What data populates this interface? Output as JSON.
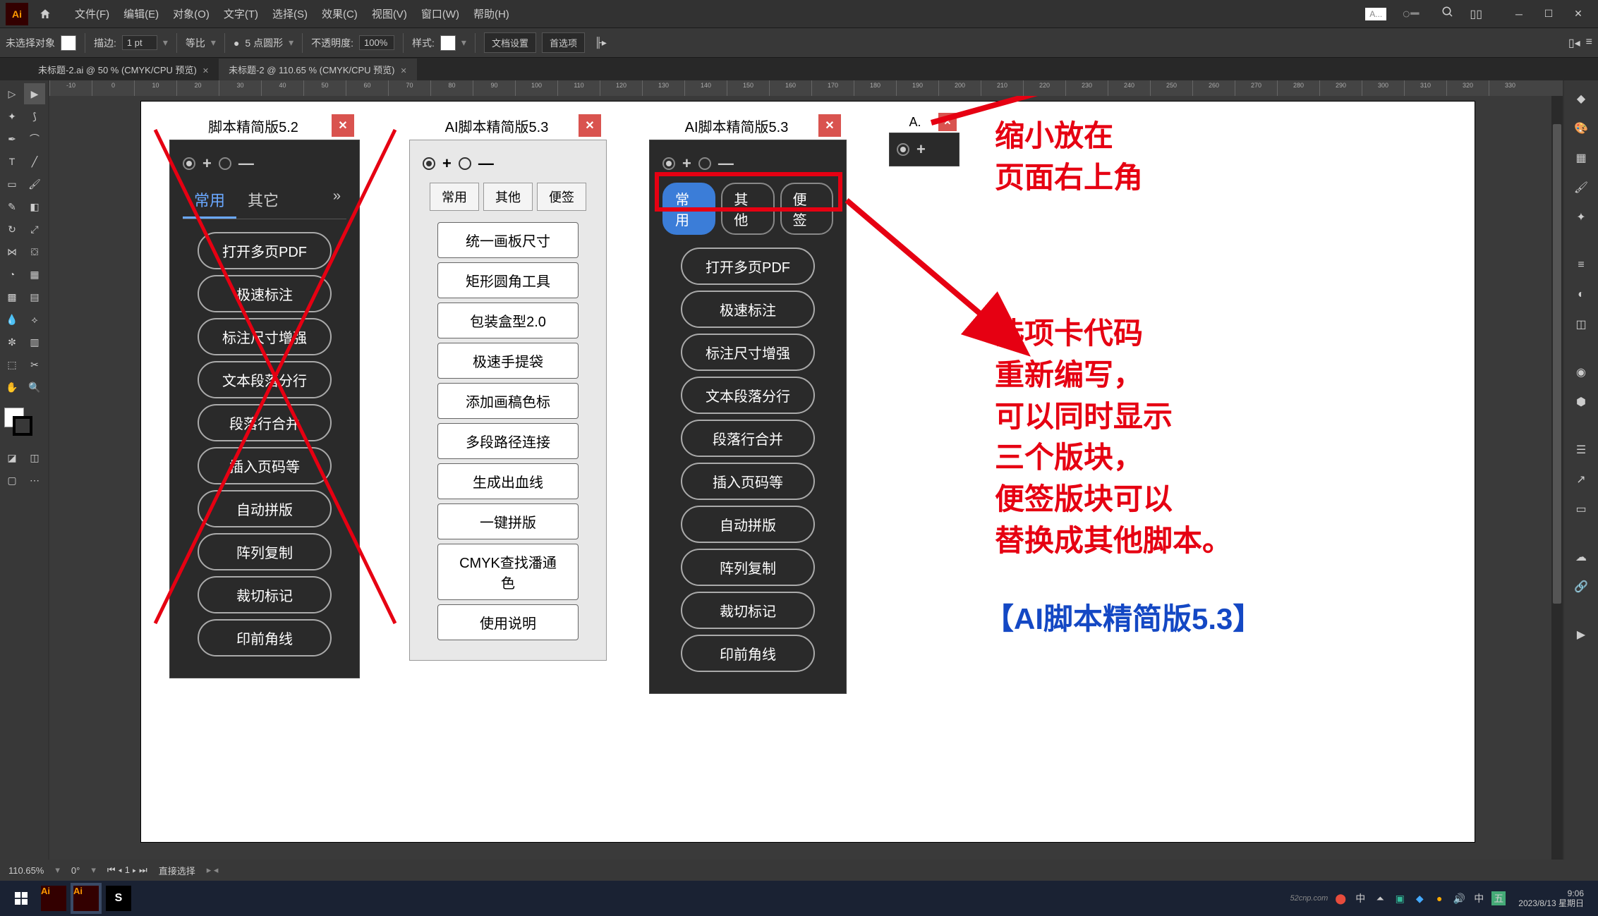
{
  "menubar": {
    "logo": "Ai",
    "items": [
      "文件(F)",
      "编辑(E)",
      "对象(O)",
      "文字(T)",
      "选择(S)",
      "效果(C)",
      "视图(V)",
      "窗口(W)",
      "帮助(H)"
    ],
    "dock_label": "A..."
  },
  "controlbar": {
    "no_selection": "未选择对象",
    "stroke_label": "描边:",
    "stroke_value": "1 pt",
    "uniform": "等比",
    "style_label": "5 点圆形",
    "opacity_label": "不透明度:",
    "opacity_value": "100%",
    "mode_label": "样式:",
    "doc_setup": "文档设置",
    "prefs": "首选项"
  },
  "tabs": [
    {
      "label": "未标题-2.ai @ 50 % (CMYK/CPU 预览)"
    },
    {
      "label": "未标题-2 @ 110.65 % (CMYK/CPU 预览)"
    }
  ],
  "ruler_ticks": [
    "-10",
    "0",
    "10",
    "20",
    "30",
    "40",
    "50",
    "60",
    "70",
    "80",
    "90",
    "100",
    "110",
    "120",
    "130",
    "140",
    "150",
    "160",
    "170",
    "180",
    "190",
    "200",
    "210",
    "220",
    "230",
    "240",
    "250",
    "260",
    "270",
    "280",
    "290",
    "300",
    "310",
    "320",
    "330"
  ],
  "panel1": {
    "title": "脚本精简版5.2",
    "tabs": [
      "常用",
      "其它"
    ],
    "buttons": [
      "打开多页PDF",
      "极速标注",
      "标注尺寸增强",
      "文本段落分行",
      "段落行合并",
      "插入页码等",
      "自动拼版",
      "阵列复制",
      "裁切标记",
      "印前角线"
    ]
  },
  "panel2": {
    "title": "AI脚本精简版5.3",
    "tabs": [
      "常用",
      "其他",
      "便签"
    ],
    "buttons": [
      "统一画板尺寸",
      "矩形圆角工具",
      "包装盒型2.0",
      "极速手提袋",
      "添加画稿色标",
      "多段路径连接",
      "生成出血线",
      "一键拼版",
      "CMYK查找潘通色",
      "使用说明"
    ]
  },
  "panel3": {
    "title": "AI脚本精简版5.3",
    "tabs": [
      "常用",
      "其他",
      "便签"
    ],
    "buttons": [
      "打开多页PDF",
      "极速标注",
      "标注尺寸增强",
      "文本段落分行",
      "段落行合并",
      "插入页码等",
      "自动拼版",
      "阵列复制",
      "裁切标记",
      "印前角线"
    ]
  },
  "panel4": {
    "title": "A."
  },
  "annotations": {
    "top1": "缩小放在",
    "top2": "页面右上角",
    "mid1": "选项卡代码",
    "mid2": "重新编写，",
    "mid3": "可以同时显示",
    "mid4": "三个版块，",
    "mid5": "便签版块可以",
    "mid6": "替换成其他脚本。",
    "title": "【AI脚本精简版5.3】"
  },
  "zoom_symbols": {
    "plus": "+",
    "minus": "—"
  },
  "status": {
    "zoom": "110.65%",
    "rotate": "0°",
    "artboard": "1",
    "tool": "直接选择"
  },
  "taskbar": {
    "time": "9:06",
    "date": "2023/8/13 星期日",
    "watermark": "52cnp.com"
  }
}
